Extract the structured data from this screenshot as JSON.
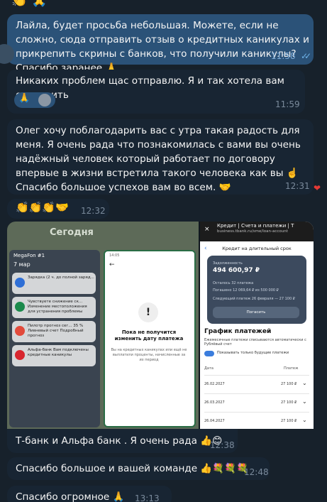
{
  "top_emojis": "👏 🙏",
  "messages": [
    {
      "text": "Лайла, будет просьба небольшая. Можете, если не сложно, сюда отправить отзыв о кредитных каникулах и прикрепить скрины с банков, что получили каникулы? Спасибо заранее 🙏",
      "time": "11:58"
    },
    {
      "text": "Никаких проблем щас отправлю. Я и так хотела вам отправить",
      "time": "11:59"
    },
    {
      "text": "Олег  хочу  поблагодарить вас  с утра такая радость для меня. Я очень рада что познакомилась с вами вы очень надёжный человек который работает по договору  впервые в жизни встретила такого человека как вы ☝️ Спасибо большое успехов вам во всем. 🤝",
      "time": "12:31"
    },
    {
      "text": "👏👏👏🤝",
      "time": "12:32"
    },
    {
      "text": "Т-банк и Альфа банк . Я очень рада 👍😊",
      "time": "12:38"
    },
    {
      "text": "Спасибо большое и вашей команде 👍💐💐💐",
      "time": "12:48"
    },
    {
      "text": "Спасибо огромное 🙏",
      "time": "13:13"
    }
  ],
  "reaction_chip": "🙏",
  "heart": "❤",
  "album": {
    "date_label": "Сегодня",
    "lock": {
      "carrier": "MegaFon #1",
      "date": "7 мар",
      "notifs": [
        {
          "title": "Зарядка (2 ч. до полной заряд...",
          "color": "#2f6fd6"
        },
        {
          "title": "Чувствуете снижение ск... Изменение местоположения для устранения проблемы",
          "color": "#1b8a4c"
        },
        {
          "title": "Пилотр прогноз сег... 35 % Ливневый счет Подробный прогноз",
          "color": "#e24a3b"
        },
        {
          "title": "Альфа-банк Вам подключены кредитные каникулы",
          "color": "#d8262f"
        }
      ]
    },
    "dialog": {
      "time": "14:05",
      "title": "Пока не получится изменить дату платежа",
      "body": "Вы на кредитных каникулах или ещё не выплатили проценты, начисленные за их период"
    },
    "bank": {
      "bar_title": "Кредит | Счета и платежи | Т",
      "bar_url": "business.tbank.ru/sme/loan-account",
      "header": "Кредит на длительный срок",
      "debt_label": "Задолженность",
      "debt": "494 600,97 ₽",
      "left": "Осталось  32 платежа",
      "paid": "Погашено 12 069,64 ₽ из 500 000 ₽",
      "next": "Следующий платеж  26 февраля — 27 100 ₽",
      "pay_btn": "Погасить",
      "schedule_title": "График платежей",
      "schedule_sub": "Ежемесячные платежи списываются автоматически с Рублёвый счет",
      "toggle_label": "Показывать только будущие платежи",
      "col_date": "Дата",
      "col_pay": "Платеж",
      "rows": [
        {
          "date": "26.02.2027",
          "amount": "27 100 ₽"
        },
        {
          "date": "26.03.2027",
          "amount": "27 100 ₽"
        },
        {
          "date": "26.04.2027",
          "amount": "27 100 ₽"
        }
      ]
    }
  }
}
